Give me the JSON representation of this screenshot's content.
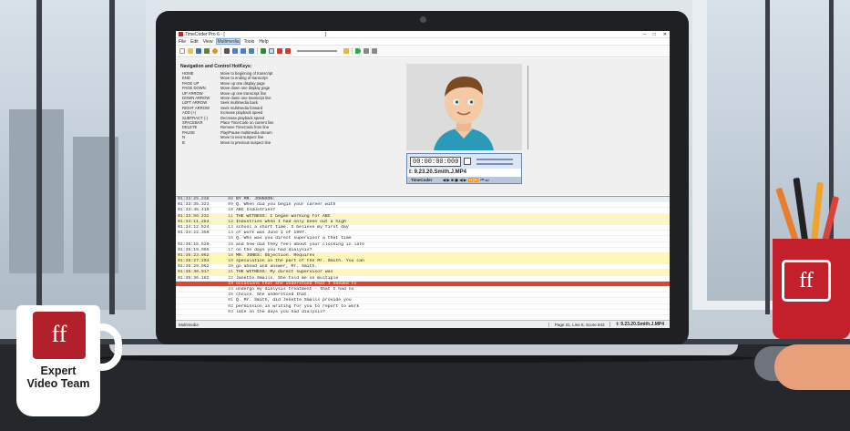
{
  "app": {
    "title": "TimeCoder Pro 6 - [",
    "title_right": "]",
    "window_buttons": [
      "–",
      "□",
      "✕"
    ],
    "menu": [
      "File",
      "Edit",
      "View",
      "Multimedia",
      "Tools",
      "Help"
    ],
    "active_menu": "Multimedia"
  },
  "toolbar": {
    "icons": [
      "new-icon",
      "open-icon",
      "save-icon",
      "print-icon",
      "refresh-icon",
      "find-icon",
      "link-icon",
      "link-icon",
      "link-icon",
      "check-icon",
      "tc-icon",
      "up-arrow-icon",
      "down-arrow-icon",
      "play-icon",
      "pause-icon",
      "stop-icon"
    ]
  },
  "hotkeys": {
    "title": "Navigation and Control HotKeys:",
    "rows": [
      {
        "key": "HOME",
        "desc": "Move to beginning of transcript"
      },
      {
        "key": "END",
        "desc": "Move to ending of transcript"
      },
      {
        "key": "",
        "desc": ""
      },
      {
        "key": "PAGE UP",
        "desc": "Move up one display page"
      },
      {
        "key": "PAGE DOWN",
        "desc": "Move down one display page"
      },
      {
        "key": "",
        "desc": ""
      },
      {
        "key": "UP ARROW",
        "desc": "Move up one transcript line"
      },
      {
        "key": "DOWN ARROW",
        "desc": "Move down one transcript line"
      },
      {
        "key": "",
        "desc": ""
      },
      {
        "key": "LEFT ARROW",
        "desc": "Seek multimedia back"
      },
      {
        "key": "RIGHT ARROW",
        "desc": "Seek multimedia forward"
      },
      {
        "key": "",
        "desc": ""
      },
      {
        "key": "ADD (+)",
        "desc": "Increase playback speed"
      },
      {
        "key": "SUBTRACT (-)",
        "desc": "Decrease playback speed"
      },
      {
        "key": "",
        "desc": ""
      },
      {
        "key": "SPACEBAR",
        "desc": "Place TimeCode on current line"
      },
      {
        "key": "DELETE",
        "desc": "Remove TimeCode from line"
      },
      {
        "key": "",
        "desc": ""
      },
      {
        "key": "PAUSE",
        "desc": "Play/Pause multimedia stream"
      },
      {
        "key": "",
        "desc": ""
      },
      {
        "key": "N",
        "desc": "Move to next suspect line"
      },
      {
        "key": "B",
        "desc": "Move to previous suspect line"
      }
    ]
  },
  "player": {
    "timecode": "00:00:00:000",
    "filename": "t: 9.23.20.Smith.J.MP4",
    "bar_label": "TimeCoder"
  },
  "transcript": [
    {
      "time": "01:33:25.238",
      "line": "08",
      "text": "BY MR. JOHNSON:",
      "style": "gray"
    },
    {
      "time": "01:33:35.323",
      "line": "09",
      "text": "    Q.  When did you begin your career with",
      "style": ""
    },
    {
      "time": "01:33:45.419",
      "line": "10",
      "text": "ABC Industries?",
      "style": ""
    },
    {
      "time": "01:33:56.232",
      "line": "11",
      "text": "          THE WITNESS:  I began working for ABC",
      "style": "hl"
    },
    {
      "time": "01:34:11.284",
      "line": "12",
      "text": "    Industries when I had only been out a high",
      "style": "hl"
    },
    {
      "time": "01:34:12.524",
      "line": "13",
      "text": "    school a short time.  I believe my first day",
      "style": ""
    },
    {
      "time": "01:34:22.350",
      "line": "14",
      "text": "    of work was June 1 of 1997.",
      "style": ""
    },
    {
      "time": "",
      "line": "16",
      "text": "    Q.  Who was you direct supervisor a that time",
      "style": ""
    },
    {
      "time": "01:35:15.520",
      "line": "16",
      "text": "and how did they feel about your clocking in late",
      "style": ""
    },
    {
      "time": "01:35:19.905",
      "line": "17",
      "text": "on the days you had dialysis?",
      "style": ""
    },
    {
      "time": "01:35:23.962",
      "line": "18",
      "text": "          MR. JONES:  Objection.  Requires",
      "style": "hl"
    },
    {
      "time": "01:35:27.203",
      "line": "19",
      "text": "speculation on the part of the Mr. Smith. You can",
      "style": "hl"
    },
    {
      "time": "01:35:29.962",
      "line": "20",
      "text": "go ahead and answer, Mr. Smith.",
      "style": ""
    },
    {
      "time": "01:35:30.917",
      "line": "21",
      "text": "          THE WITNESS:  My direct supervisor was",
      "style": "hl"
    },
    {
      "time": "01:35:36.182",
      "line": "22",
      "text": "Janette Smalls.  She told me on multiple",
      "style": ""
    },
    {
      "time": "",
      "line": "23",
      "text": "occasions that she understood that I needed to",
      "style": "cur"
    },
    {
      "time": "",
      "line": "24",
      "text": "undergo my dialysis treatment - that I had no",
      "style": ""
    },
    {
      "time": "",
      "line": "25",
      "text": "choice.  She understood that.",
      "style": ""
    },
    {
      "time": "",
      "line": "01",
      "text": "    Q.  Mr. Smith, did Jenette Smalls provide you",
      "style": ""
    },
    {
      "time": "",
      "line": "02",
      "text": "permission in writing for you to report to work",
      "style": ""
    },
    {
      "time": "",
      "line": "03",
      "text": "late on the days you had dialysis?",
      "style": ""
    }
  ],
  "status": {
    "mode": "Multimedia",
    "position": "Page 31, Line 8, Score 843",
    "file": "t: 9.23.20.Smith.J.MP4"
  },
  "branding": {
    "mug_line1": "Expert",
    "mug_line2": "Video Team"
  }
}
